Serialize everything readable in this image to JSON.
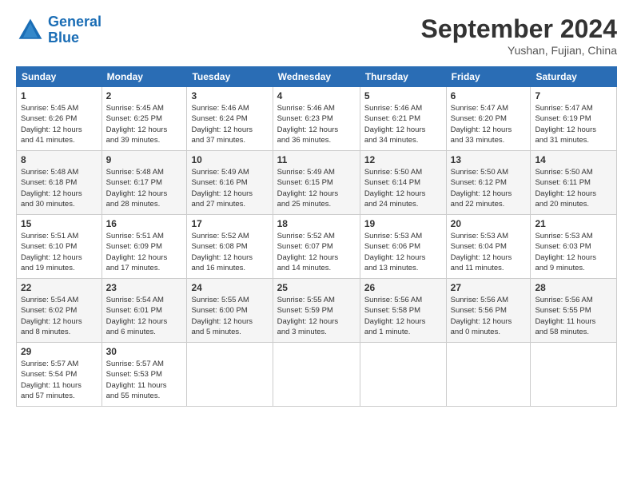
{
  "header": {
    "logo_line1": "General",
    "logo_line2": "Blue",
    "month_title": "September 2024",
    "location": "Yushan, Fujian, China"
  },
  "weekdays": [
    "Sunday",
    "Monday",
    "Tuesday",
    "Wednesday",
    "Thursday",
    "Friday",
    "Saturday"
  ],
  "weeks": [
    [
      {
        "day": "1",
        "info": "Sunrise: 5:45 AM\nSunset: 6:26 PM\nDaylight: 12 hours\nand 41 minutes."
      },
      {
        "day": "2",
        "info": "Sunrise: 5:45 AM\nSunset: 6:25 PM\nDaylight: 12 hours\nand 39 minutes."
      },
      {
        "day": "3",
        "info": "Sunrise: 5:46 AM\nSunset: 6:24 PM\nDaylight: 12 hours\nand 37 minutes."
      },
      {
        "day": "4",
        "info": "Sunrise: 5:46 AM\nSunset: 6:23 PM\nDaylight: 12 hours\nand 36 minutes."
      },
      {
        "day": "5",
        "info": "Sunrise: 5:46 AM\nSunset: 6:21 PM\nDaylight: 12 hours\nand 34 minutes."
      },
      {
        "day": "6",
        "info": "Sunrise: 5:47 AM\nSunset: 6:20 PM\nDaylight: 12 hours\nand 33 minutes."
      },
      {
        "day": "7",
        "info": "Sunrise: 5:47 AM\nSunset: 6:19 PM\nDaylight: 12 hours\nand 31 minutes."
      }
    ],
    [
      {
        "day": "8",
        "info": "Sunrise: 5:48 AM\nSunset: 6:18 PM\nDaylight: 12 hours\nand 30 minutes."
      },
      {
        "day": "9",
        "info": "Sunrise: 5:48 AM\nSunset: 6:17 PM\nDaylight: 12 hours\nand 28 minutes."
      },
      {
        "day": "10",
        "info": "Sunrise: 5:49 AM\nSunset: 6:16 PM\nDaylight: 12 hours\nand 27 minutes."
      },
      {
        "day": "11",
        "info": "Sunrise: 5:49 AM\nSunset: 6:15 PM\nDaylight: 12 hours\nand 25 minutes."
      },
      {
        "day": "12",
        "info": "Sunrise: 5:50 AM\nSunset: 6:14 PM\nDaylight: 12 hours\nand 24 minutes."
      },
      {
        "day": "13",
        "info": "Sunrise: 5:50 AM\nSunset: 6:12 PM\nDaylight: 12 hours\nand 22 minutes."
      },
      {
        "day": "14",
        "info": "Sunrise: 5:50 AM\nSunset: 6:11 PM\nDaylight: 12 hours\nand 20 minutes."
      }
    ],
    [
      {
        "day": "15",
        "info": "Sunrise: 5:51 AM\nSunset: 6:10 PM\nDaylight: 12 hours\nand 19 minutes."
      },
      {
        "day": "16",
        "info": "Sunrise: 5:51 AM\nSunset: 6:09 PM\nDaylight: 12 hours\nand 17 minutes."
      },
      {
        "day": "17",
        "info": "Sunrise: 5:52 AM\nSunset: 6:08 PM\nDaylight: 12 hours\nand 16 minutes."
      },
      {
        "day": "18",
        "info": "Sunrise: 5:52 AM\nSunset: 6:07 PM\nDaylight: 12 hours\nand 14 minutes."
      },
      {
        "day": "19",
        "info": "Sunrise: 5:53 AM\nSunset: 6:06 PM\nDaylight: 12 hours\nand 13 minutes."
      },
      {
        "day": "20",
        "info": "Sunrise: 5:53 AM\nSunset: 6:04 PM\nDaylight: 12 hours\nand 11 minutes."
      },
      {
        "day": "21",
        "info": "Sunrise: 5:53 AM\nSunset: 6:03 PM\nDaylight: 12 hours\nand 9 minutes."
      }
    ],
    [
      {
        "day": "22",
        "info": "Sunrise: 5:54 AM\nSunset: 6:02 PM\nDaylight: 12 hours\nand 8 minutes."
      },
      {
        "day": "23",
        "info": "Sunrise: 5:54 AM\nSunset: 6:01 PM\nDaylight: 12 hours\nand 6 minutes."
      },
      {
        "day": "24",
        "info": "Sunrise: 5:55 AM\nSunset: 6:00 PM\nDaylight: 12 hours\nand 5 minutes."
      },
      {
        "day": "25",
        "info": "Sunrise: 5:55 AM\nSunset: 5:59 PM\nDaylight: 12 hours\nand 3 minutes."
      },
      {
        "day": "26",
        "info": "Sunrise: 5:56 AM\nSunset: 5:58 PM\nDaylight: 12 hours\nand 1 minute."
      },
      {
        "day": "27",
        "info": "Sunrise: 5:56 AM\nSunset: 5:56 PM\nDaylight: 12 hours\nand 0 minutes."
      },
      {
        "day": "28",
        "info": "Sunrise: 5:56 AM\nSunset: 5:55 PM\nDaylight: 11 hours\nand 58 minutes."
      }
    ],
    [
      {
        "day": "29",
        "info": "Sunrise: 5:57 AM\nSunset: 5:54 PM\nDaylight: 11 hours\nand 57 minutes."
      },
      {
        "day": "30",
        "info": "Sunrise: 5:57 AM\nSunset: 5:53 PM\nDaylight: 11 hours\nand 55 minutes."
      },
      null,
      null,
      null,
      null,
      null
    ]
  ]
}
